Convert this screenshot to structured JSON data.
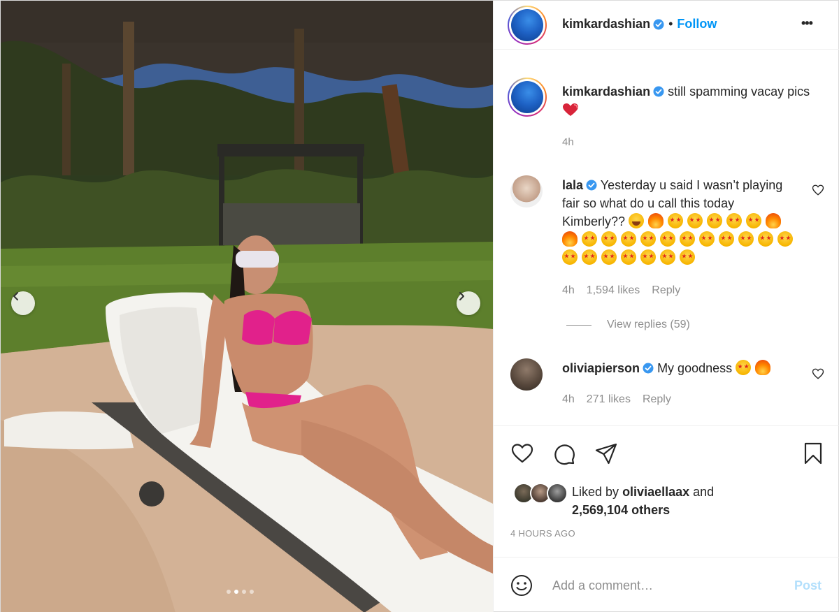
{
  "post": {
    "slide_count": 4,
    "active_slide": 2
  },
  "header": {
    "username": "kimkardashian",
    "separator": "•",
    "follow_label": "Follow",
    "more_label": "•••"
  },
  "caption": {
    "username": "kimkardashian",
    "text": "still spamming vacay pics",
    "time": "4h"
  },
  "comments": [
    {
      "username": "lala",
      "text": "Yesterday u said I wasn’t playing fair so what do u call this today Kimberly??",
      "emojis": [
        "laugh",
        "fire",
        "star",
        "star",
        "star",
        "star",
        "star",
        "fire",
        "fire",
        "star",
        "star",
        "star",
        "star",
        "star",
        "star",
        "star",
        "star",
        "star",
        "star",
        "star",
        "star",
        "star",
        "star",
        "star",
        "star",
        "star",
        "star"
      ],
      "time": "4h",
      "likes": "1,594 likes",
      "reply_label": "Reply",
      "view_replies": "View replies (59)"
    },
    {
      "username": "oliviapierson",
      "text": "My goodness",
      "emojis": [
        "star",
        "fire"
      ],
      "time": "4h",
      "likes": "271 likes",
      "reply_label": "Reply"
    }
  ],
  "likes": {
    "prefix": "Liked by",
    "user": "oliviaellaax",
    "and": "and",
    "others": "2,569,104 others"
  },
  "timestamp": "4 HOURS AGO",
  "add_comment": {
    "placeholder": "Add a comment…",
    "post_label": "Post"
  },
  "colors": {
    "accent": "#0095f6",
    "post_disabled": "#b2dffc",
    "verified": "#3897f0",
    "muted": "#8e8e8e"
  }
}
